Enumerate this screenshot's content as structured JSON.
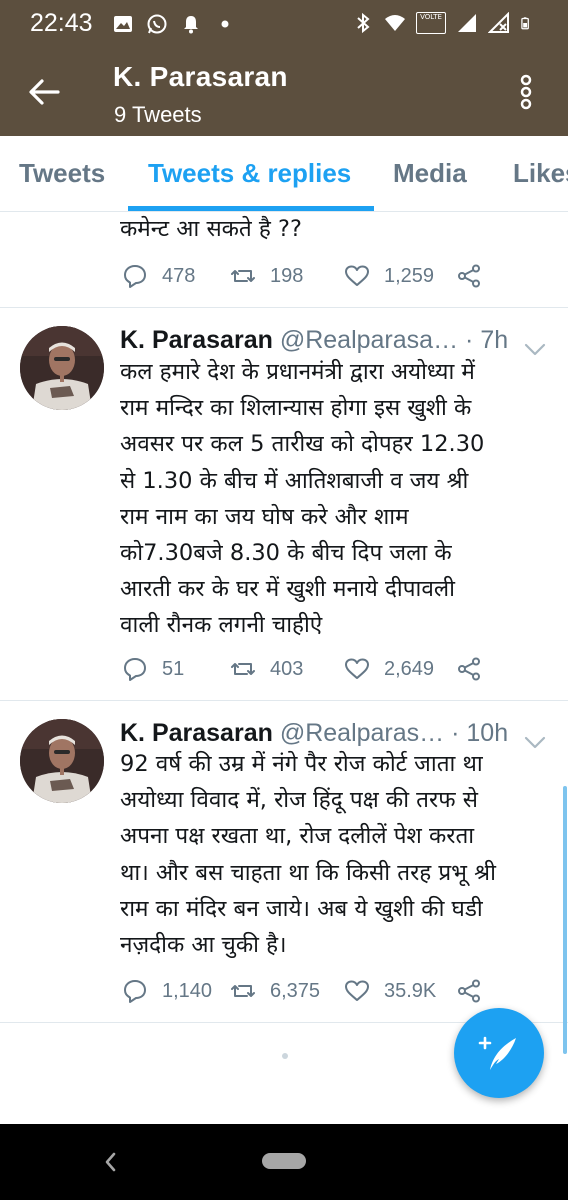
{
  "status_bar": {
    "time": "22:43",
    "network_label": "VOLTE"
  },
  "header": {
    "name": "K. Parasaran",
    "tweet_count": "9 Tweets"
  },
  "tabs": [
    {
      "label": "Tweets",
      "active": false
    },
    {
      "label": "Tweets & replies",
      "active": true
    },
    {
      "label": "Media",
      "active": false
    },
    {
      "label": "Likes",
      "active": false
    }
  ],
  "tweets": [
    {
      "text_lines": [
        "कमेन्ट आ सकते है ??"
      ],
      "replies": "478",
      "retweets": "198",
      "likes": "1,259"
    },
    {
      "author": "K. Parasaran",
      "handle": "@Realparasa…",
      "time": "7h",
      "text_lines": [
        "कल हमारे देश के प्रधानमंत्री द्वारा अयोध्या में",
        "राम मन्दिर का शिलान्यास होगा इस खुशी के",
        "अवसर पर कल 5 तारीख को  दोपहर 12.30",
        "से 1.30 के बीच में आतिशबाजी व जय श्री",
        "राम नाम का जय घोष करे और शाम",
        "को7.30बजे 8.30 के बीच दिप जला के",
        "आरती कर के घर में खुशी मनाये दीपावली",
        "वाली रौनक लगनी चाहीऐ"
      ],
      "replies": "51",
      "retweets": "403",
      "likes": "2,649"
    },
    {
      "author": "K. Parasaran",
      "handle": "@Realparas…",
      "time": "10h",
      "text_lines": [
        "92 वर्ष की उम्र में नंगे पैर रोज कोर्ट जाता था",
        "अयोध्या विवाद में, रोज हिंदू पक्ष की तरफ से",
        "अपना पक्ष रखता था,  रोज दलीलें पेश करता",
        "था। और बस चाहता था कि किसी तरह प्रभू श्री",
        "राम का मंदिर बन जाये। अब ये खुशी की घडी",
        "नज़दीक आ चुकी है।"
      ],
      "replies": "1,140",
      "retweets": "6,375",
      "likes": "35.9K"
    }
  ],
  "icons": {
    "reply": "reply-icon",
    "retweet": "retweet-icon",
    "like": "heart-icon",
    "share": "share-icon",
    "compose": "compose-tweet-icon"
  },
  "colors": {
    "header_bg": "#5c4f3e",
    "accent": "#1da1f2",
    "secondary_text": "#657786"
  }
}
